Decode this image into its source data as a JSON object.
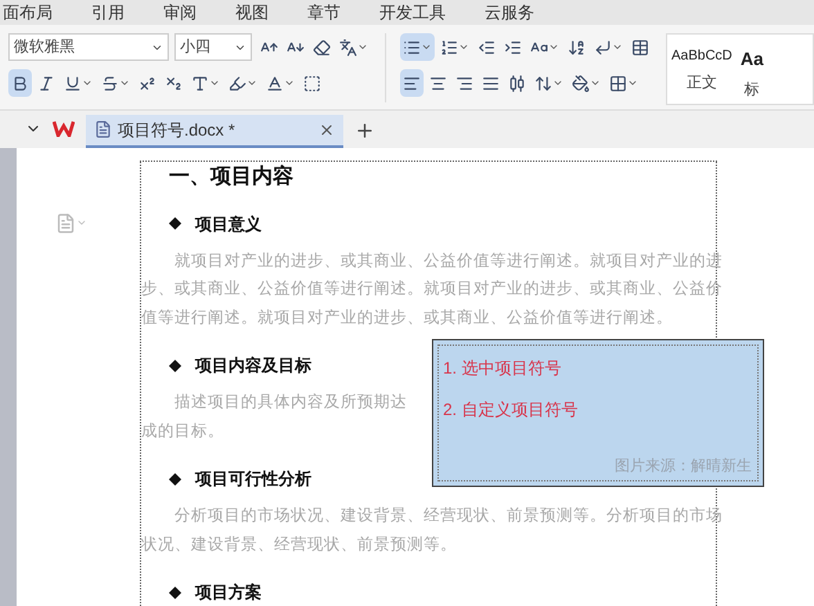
{
  "menu": [
    "面布局",
    "引用",
    "审阅",
    "视图",
    "章节",
    "开发工具",
    "云服务"
  ],
  "toolbar": {
    "font_field": {
      "value": "微软雅黑"
    },
    "size_field": {
      "value": "小四"
    },
    "font_tools_1": [
      {
        "kind": "grow",
        "selected": false,
        "dropdown": false
      },
      {
        "kind": "shrink",
        "selected": false,
        "dropdown": false
      },
      {
        "kind": "clear",
        "selected": false,
        "dropdown": false
      },
      {
        "kind": "pinyin",
        "selected": false,
        "dropdown": true
      }
    ],
    "font_tools_2": [
      {
        "kind": "bold",
        "selected": true,
        "dropdown": false
      },
      {
        "kind": "italic",
        "selected": false,
        "dropdown": false
      },
      {
        "kind": "underline",
        "selected": false,
        "dropdown": true
      },
      {
        "kind": "strike",
        "selected": false,
        "dropdown": true
      },
      {
        "kind": "superscript",
        "selected": false,
        "dropdown": false
      },
      {
        "kind": "subscript",
        "selected": false,
        "dropdown": false
      },
      {
        "kind": "effect",
        "selected": false,
        "dropdown": true
      },
      {
        "kind": "highlight",
        "selected": false,
        "dropdown": true
      },
      {
        "kind": "color",
        "selected": false,
        "dropdown": true
      },
      {
        "kind": "shading",
        "selected": false,
        "dropdown": false
      }
    ],
    "para_tools_1": [
      {
        "kind": "bullets",
        "selected": true,
        "dropdown": true
      },
      {
        "kind": "numbering",
        "selected": false,
        "dropdown": true
      },
      {
        "kind": "outdent",
        "selected": false,
        "dropdown": false
      },
      {
        "kind": "indent",
        "selected": false,
        "dropdown": false
      },
      {
        "kind": "textsize",
        "selected": false,
        "dropdown": true
      },
      {
        "kind": "sort",
        "selected": false,
        "dropdown": false
      },
      {
        "kind": "mark",
        "selected": false,
        "dropdown": true
      },
      {
        "kind": "table",
        "selected": false,
        "dropdown": false
      }
    ],
    "para_tools_2": [
      {
        "kind": "left",
        "selected": true,
        "dropdown": false
      },
      {
        "kind": "center",
        "selected": false,
        "dropdown": false
      },
      {
        "kind": "right",
        "selected": false,
        "dropdown": false
      },
      {
        "kind": "justify",
        "selected": false,
        "dropdown": false
      },
      {
        "kind": "distribute",
        "selected": false,
        "dropdown": false
      },
      {
        "kind": "spacing",
        "selected": false,
        "dropdown": true
      },
      {
        "kind": "fill",
        "selected": false,
        "dropdown": true
      },
      {
        "kind": "borders",
        "selected": false,
        "dropdown": true
      }
    ],
    "styles": [
      {
        "preview": "AaBbCcD",
        "label": "正文",
        "bold": false
      },
      {
        "preview": "Aa",
        "label": "标",
        "bold": true
      }
    ]
  },
  "tabs": [
    {
      "label": "项目符号.docx *",
      "selected": true
    }
  ],
  "document": {
    "title": "一、项目内容",
    "sections": [
      {
        "heading": "项目意义",
        "lines": [
          "就项目对产业的进步、或其商业、公益价值等进行阐述。就项目对产业的进",
          "步、或其商业、公益价值等进行阐述。就项目对产业的进步、或其商业、公益价",
          "值等进行阐述。就项目对产业的进步、或其商业、公益价值等进行阐述。"
        ]
      },
      {
        "heading": "项目内容及目标",
        "lines": [
          "描述项目的具体内容及所预期达",
          "成的目标。"
        ]
      },
      {
        "heading": "项目可行性分析",
        "lines": [
          "分析项目的市场状况、建设背景、经营现状、前景预测等。分析项目的市场",
          "状况、建设背景、经营现状、前景预测等。"
        ]
      },
      {
        "heading": "项目方案"
      }
    ]
  },
  "note": {
    "items": [
      "1. 选中项目符号",
      "2. 自定义项目符号"
    ],
    "caption": "图片来源：解晴新生"
  }
}
